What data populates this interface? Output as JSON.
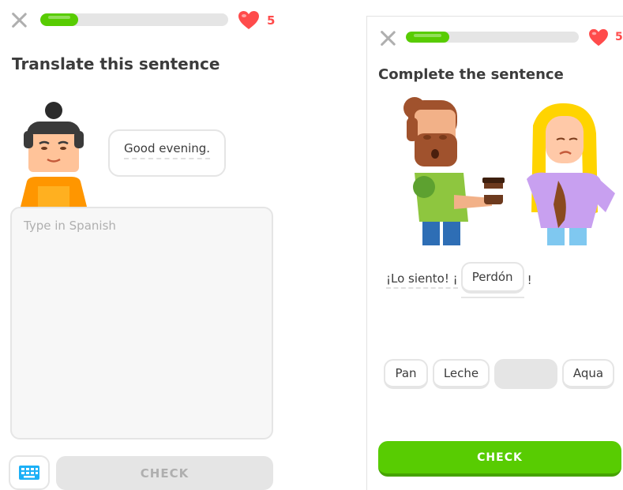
{
  "colors": {
    "green": "#58cc02",
    "green_dark": "#46a302",
    "red": "#ff4b4b",
    "gray": "#e5e5e5",
    "text": "#3c3c3c",
    "muted": "#afafaf"
  },
  "translate_screen": {
    "progress_fraction": 0.2,
    "hearts_count": "5",
    "title": "Translate this sentence",
    "speech_text": "Good evening.",
    "input_placeholder": "Type in Spanish",
    "keyboard_icon": "keyboard-icon",
    "check_label": "CHECK"
  },
  "complete_screen": {
    "progress_fraction": 0.25,
    "hearts_count": "5",
    "title": "Complete the sentence",
    "sentence_prefix": "¡Lo siento! ¡",
    "blank_answer": "Perdón",
    "sentence_suffix": "!",
    "word_bank": [
      "Pan",
      "Leche",
      "",
      "Aqua"
    ],
    "check_label": "CHECK"
  }
}
